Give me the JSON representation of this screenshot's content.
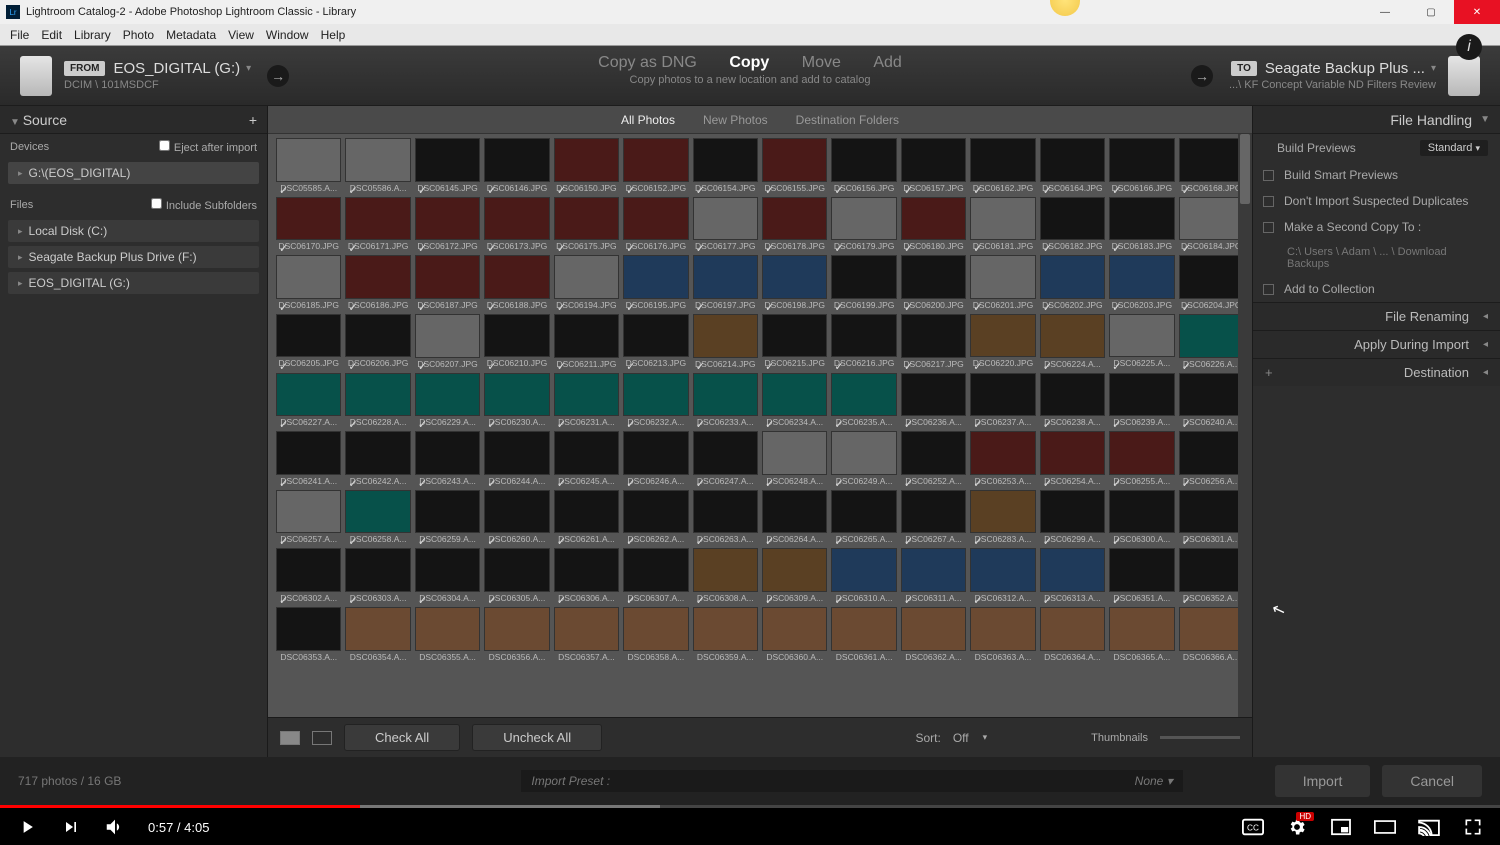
{
  "window": {
    "title": "Lightroom Catalog-2 - Adobe Photoshop Lightroom Classic - Library"
  },
  "menu": [
    "File",
    "Edit",
    "Library",
    "Photo",
    "Metadata",
    "View",
    "Window",
    "Help"
  ],
  "source": {
    "from": "FROM",
    "drive": "EOS_DIGITAL (G:)",
    "path": "DCIM \\ 101MSDCF"
  },
  "dest": {
    "to": "TO",
    "drive": "Seagate Backup Plus ...",
    "path": "...\\ KF Concept Variable ND Filters Review"
  },
  "actions": {
    "dng": "Copy as DNG",
    "copy": "Copy",
    "move": "Move",
    "add": "Add",
    "sub": "Copy photos to a new location and add to catalog"
  },
  "view_tabs": {
    "all": "All Photos",
    "new": "New Photos",
    "dest": "Destination Folders"
  },
  "left": {
    "source": "Source",
    "devices": "Devices",
    "eject": "Eject after import",
    "dev_item": "G:\\(EOS_DIGITAL)",
    "files": "Files",
    "include_sub": "Include Subfolders",
    "drives": [
      "Local Disk (C:)",
      "Seagate Backup Plus Drive (F:)",
      "EOS_DIGITAL (G:)"
    ]
  },
  "right": {
    "fh": "File Handling",
    "build": "Build Previews",
    "build_val": "Standard",
    "smart": "Build Smart Previews",
    "dup": "Don't Import Suspected Duplicates",
    "copy2": "Make a Second Copy To :",
    "copy2_path": "C:\\ Users \\ Adam \\ ... \\ Download Backups",
    "coll": "Add to Collection",
    "rename": "File Renaming",
    "apply": "Apply During Import",
    "desthead": "Destination"
  },
  "footer": {
    "check_all": "Check All",
    "uncheck_all": "Uncheck All",
    "sort": "Sort:",
    "sort_val": "Off",
    "thumbs": "Thumbnails",
    "count": "717 photos / 16 GB",
    "preset_label": "Import Preset :",
    "preset_val": "None",
    "import": "Import",
    "cancel": "Cancel"
  },
  "player": {
    "time": "0:57 / 4:05",
    "hd": "HD"
  },
  "thumbs": [
    [
      "DSC05585.A...",
      "DSC05586.A...",
      "DSC06145.JPG",
      "DSC06146.JPG",
      "DSC06150.JPG",
      "DSC06152.JPG",
      "DSC06154.JPG",
      "DSC06155.JPG",
      "DSC06156.JPG",
      "DSC06157.JPG",
      "DSC06162.JPG",
      "DSC06164.JPG",
      "DSC06166.JPG",
      "DSC06168.JPG"
    ],
    [
      "DSC06170.JPG",
      "DSC06171.JPG",
      "DSC06172.JPG",
      "DSC06173.JPG",
      "DSC06175.JPG",
      "DSC06176.JPG",
      "DSC06177.JPG",
      "DSC06178.JPG",
      "DSC06179.JPG",
      "DSC06180.JPG",
      "DSC06181.JPG",
      "DSC06182.JPG",
      "DSC06183.JPG",
      "DSC06184.JPG"
    ],
    [
      "DSC06185.JPG",
      "DSC06186.JPG",
      "DSC06187.JPG",
      "DSC06188.JPG",
      "DSC06194.JPG",
      "DSC06195.JPG",
      "DSC06197.JPG",
      "DSC06198.JPG",
      "DSC06199.JPG",
      "DSC06200.JPG",
      "DSC06201.JPG",
      "DSC06202.JPG",
      "DSC06203.JPG",
      "DSC06204.JPG"
    ],
    [
      "DSC06205.JPG",
      "DSC06206.JPG",
      "DSC06207.JPG",
      "DSC06210.JPG",
      "DSC06211.JPG",
      "DSC06213.JPG",
      "DSC06214.JPG",
      "DSC06215.JPG",
      "DSC06216.JPG",
      "DSC06217.JPG",
      "DSC06220.JPG",
      "DSC06224.A...",
      "DSC06225.A...",
      "DSC06226.A..."
    ],
    [
      "DSC06227.A...",
      "DSC06228.A...",
      "DSC06229.A...",
      "DSC06230.A...",
      "DSC06231.A...",
      "DSC06232.A...",
      "DSC06233.A...",
      "DSC06234.A...",
      "DSC06235.A...",
      "DSC06236.A...",
      "DSC06237.A...",
      "DSC06238.A...",
      "DSC06239.A...",
      "DSC06240.A..."
    ],
    [
      "DSC06241.A...",
      "DSC06242.A...",
      "DSC06243.A...",
      "DSC06244.A...",
      "DSC06245.A...",
      "DSC06246.A...",
      "DSC06247.A...",
      "DSC06248.A...",
      "DSC06249.A...",
      "DSC06252.A...",
      "DSC06253.A...",
      "DSC06254.A...",
      "DSC06255.A...",
      "DSC06256.A..."
    ],
    [
      "DSC06257.A...",
      "DSC06258.A...",
      "DSC06259.A...",
      "DSC06260.A...",
      "DSC06261.A...",
      "DSC06262.A...",
      "DSC06263.A...",
      "DSC06264.A...",
      "DSC06265.A...",
      "DSC06267.A...",
      "DSC06283.A...",
      "DSC06299.A...",
      "DSC06300.A...",
      "DSC06301.A..."
    ],
    [
      "DSC06302.A...",
      "DSC06303.A...",
      "DSC06304.A...",
      "DSC06305.A...",
      "DSC06306.A...",
      "DSC06307.A...",
      "DSC06308.A...",
      "DSC06309.A...",
      "DSC06310.A...",
      "DSC06311.A...",
      "DSC06312.A...",
      "DSC06313.A...",
      "DSC06351.A...",
      "DSC06352.A..."
    ],
    [
      "DSC06353.A...",
      "DSC06354.A...",
      "DSC06355.A...",
      "DSC06356.A...",
      "DSC06357.A...",
      "DSC06358.A...",
      "DSC06359.A...",
      "DSC06360.A...",
      "DSC06361.A...",
      "DSC06362.A...",
      "DSC06363.A...",
      "DSC06364.A...",
      "DSC06365.A...",
      "DSC06366.A..."
    ]
  ],
  "tone": [
    [
      "grey",
      "grey",
      "dark",
      "dark",
      "red",
      "red",
      "dark",
      "red",
      "dark",
      "dark",
      "dark",
      "dark",
      "dark",
      "dark"
    ],
    [
      "red",
      "red",
      "red",
      "red",
      "red",
      "red",
      "grey",
      "red",
      "grey",
      "red",
      "grey",
      "dark",
      "dark",
      "grey"
    ],
    [
      "grey",
      "red",
      "red",
      "red",
      "grey",
      "blue",
      "blue",
      "blue",
      "dark",
      "dark",
      "grey",
      "blue",
      "blue",
      "dark"
    ],
    [
      "dark",
      "dark",
      "grey",
      "dark",
      "dark",
      "dark",
      "wood",
      "dark",
      "dark",
      "dark",
      "wood",
      "wood",
      "grey",
      "green"
    ],
    [
      "green",
      "green",
      "green",
      "green",
      "green",
      "green",
      "green",
      "green",
      "green",
      "dark",
      "dark",
      "dark",
      "dark",
      "dark"
    ],
    [
      "dark",
      "dark",
      "dark",
      "dark",
      "dark",
      "dark",
      "dark",
      "grey",
      "grey",
      "dark",
      "red",
      "red",
      "red",
      "dark"
    ],
    [
      "grey",
      "green",
      "dark",
      "dark",
      "dark",
      "dark",
      "dark",
      "dark",
      "dark",
      "dark",
      "wood",
      "dark",
      "dark",
      "dark"
    ],
    [
      "dark",
      "dark",
      "dark",
      "dark",
      "dark",
      "dark",
      "wood",
      "wood",
      "blue",
      "blue",
      "blue",
      "blue",
      "dark",
      "dark"
    ],
    [
      "dark",
      "skin",
      "skin",
      "skin",
      "skin",
      "skin",
      "skin",
      "skin",
      "skin",
      "skin",
      "skin",
      "skin",
      "skin",
      "skin"
    ]
  ]
}
